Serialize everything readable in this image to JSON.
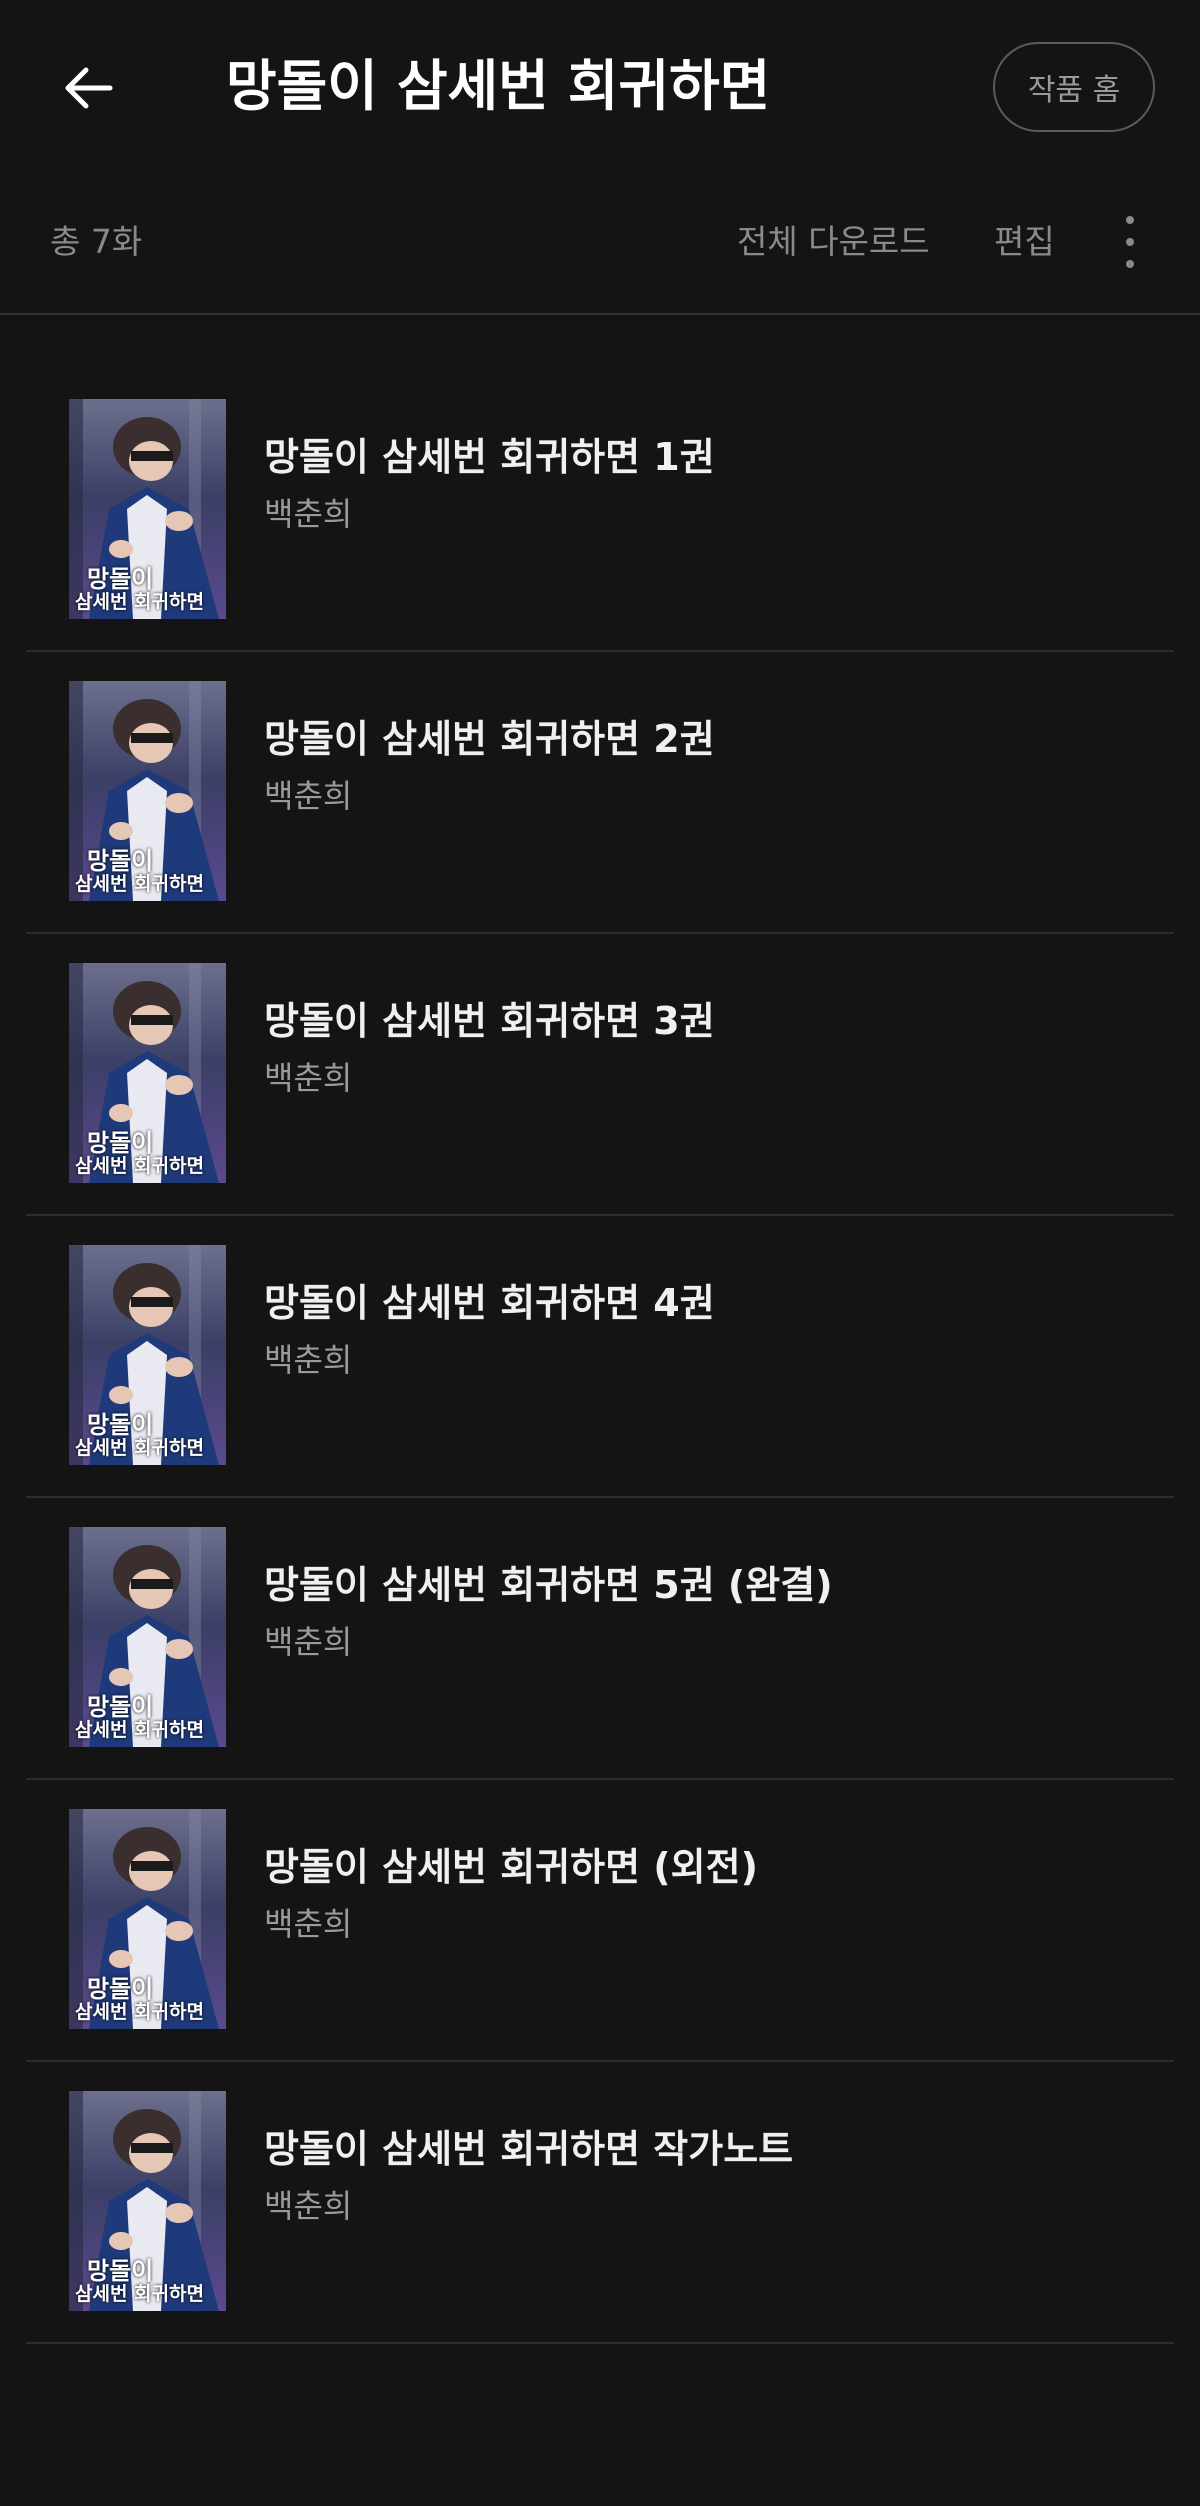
{
  "header": {
    "title": "망돌이 삼세번 회귀하면",
    "home_label": "작품 홈"
  },
  "toolbar": {
    "total_label": "총 7화",
    "download_label": "전체 다운로드",
    "edit_label": "편집"
  },
  "cover_text": {
    "line1": "망돌이",
    "line2": "삼세번 회귀하면"
  },
  "episodes": [
    {
      "title": "망돌이 삼세번 회귀하면 1권",
      "author": "백춘희"
    },
    {
      "title": "망돌이 삼세번 회귀하면 2권",
      "author": "백춘희"
    },
    {
      "title": "망돌이 삼세번 회귀하면 3권",
      "author": "백춘희"
    },
    {
      "title": "망돌이 삼세번 회귀하면 4권",
      "author": "백춘희"
    },
    {
      "title": "망돌이 삼세번 회귀하면 5권 (완결)",
      "author": "백춘희"
    },
    {
      "title": "망돌이 삼세번 회귀하면 (외전)",
      "author": "백춘희"
    },
    {
      "title": "망돌이 삼세번 회귀하면 작가노트",
      "author": "백춘희"
    }
  ],
  "colors": {
    "background": "#141414",
    "title": "#ffffff",
    "muted": "#8a8a8a",
    "divider": "#2c2c2c"
  }
}
